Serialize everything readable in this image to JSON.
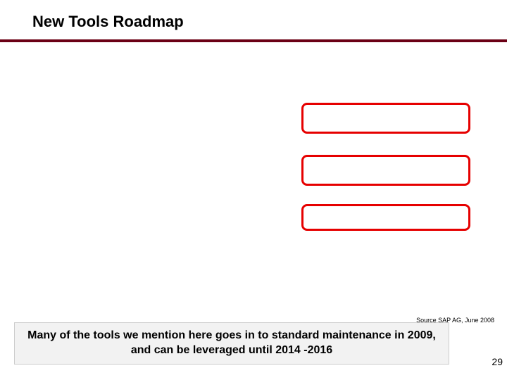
{
  "title": "New Tools Roadmap",
  "boxes": [
    {
      "label": ""
    },
    {
      "label": ""
    },
    {
      "label": ""
    }
  ],
  "source": "Source SAP AG, June 2008",
  "callout": "Many of the tools we mention here goes in to standard maintenance in 2009, and can be leveraged until 2014 -2016",
  "page_number": "29"
}
